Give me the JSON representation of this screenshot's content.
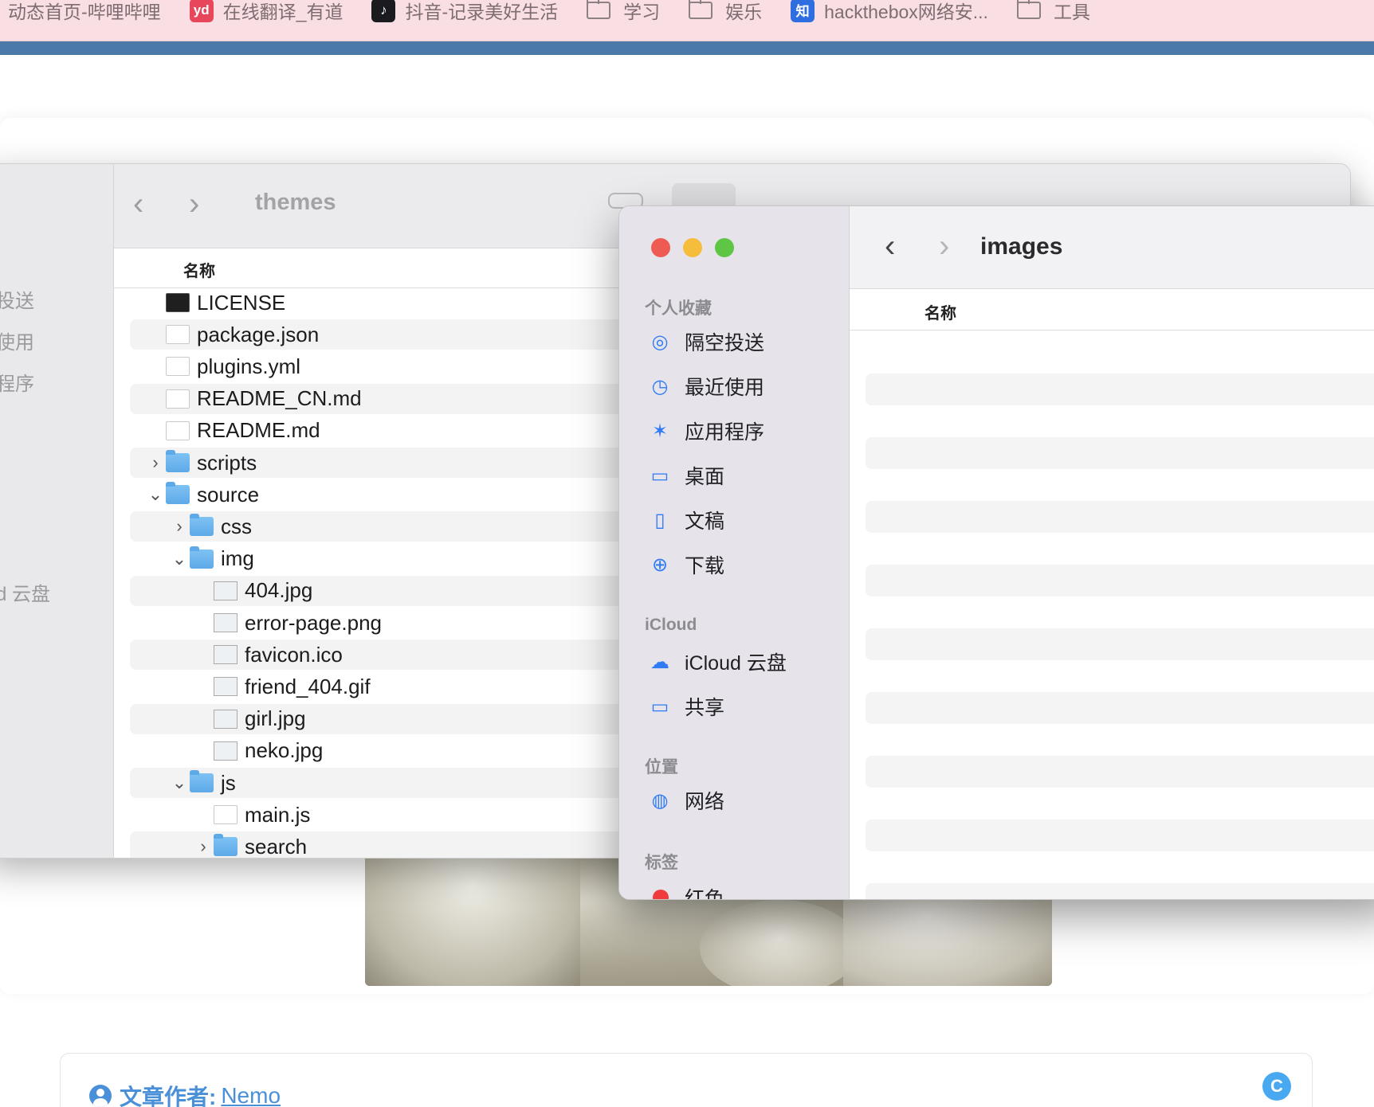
{
  "bookmarks": [
    {
      "label": "动态首页-哔哩哔哩",
      "icon": "bilibili-icon",
      "kind": "none"
    },
    {
      "label": "在线翻译_有道",
      "icon": "youdao-icon",
      "badge": "yd",
      "color": "#e8465a",
      "kind": "badge"
    },
    {
      "label": "抖音-记录美好生活",
      "icon": "douyin-icon",
      "badge": "♪",
      "color": "#1b1b1f",
      "kind": "badge"
    },
    {
      "label": "学习",
      "icon": "folder-icon",
      "kind": "folder"
    },
    {
      "label": "娱乐",
      "icon": "folder-icon",
      "kind": "folder"
    },
    {
      "label": "hackthebox网络安...",
      "icon": "zhihu-icon",
      "badge": "知",
      "color": "#2f6ee0",
      "kind": "badge"
    },
    {
      "label": "工具",
      "icon": "folder-icon",
      "kind": "folder"
    }
  ],
  "page": {
    "author_label": "文章作者:",
    "author_name": "Nemo",
    "badge": "C"
  },
  "finder_back": {
    "title": "themes",
    "column_header": "名称",
    "sidebar_partial": [
      "投送",
      "使用",
      "程序",
      "d 云盘"
    ],
    "files": [
      {
        "name": "LICENSE",
        "icon": "terminal-file-icon",
        "depth": 0,
        "expand": "",
        "alt": false
      },
      {
        "name": "package.json",
        "icon": "json-file-icon",
        "depth": 0,
        "expand": "",
        "alt": true
      },
      {
        "name": "plugins.yml",
        "icon": "yaml-file-icon",
        "depth": 0,
        "expand": "",
        "alt": false
      },
      {
        "name": "README_CN.md",
        "icon": "markdown-file-icon",
        "depth": 0,
        "expand": "",
        "alt": true
      },
      {
        "name": "README.md",
        "icon": "markdown-file-icon",
        "depth": 0,
        "expand": "",
        "alt": false
      },
      {
        "name": "scripts",
        "icon": "folder-icon",
        "depth": 0,
        "expand": "›",
        "alt": true
      },
      {
        "name": "source",
        "icon": "folder-icon",
        "depth": 0,
        "expand": "⌄",
        "alt": false
      },
      {
        "name": "css",
        "icon": "folder-icon",
        "depth": 1,
        "expand": "›",
        "alt": true
      },
      {
        "name": "img",
        "icon": "folder-icon",
        "depth": 1,
        "expand": "⌄",
        "alt": false
      },
      {
        "name": "404.jpg",
        "icon": "image-file-icon",
        "depth": 2,
        "expand": "",
        "alt": true
      },
      {
        "name": "error-page.png",
        "icon": "image-file-icon",
        "depth": 2,
        "expand": "",
        "alt": false
      },
      {
        "name": "favicon.ico",
        "icon": "image-file-icon",
        "depth": 2,
        "expand": "",
        "alt": true
      },
      {
        "name": "friend_404.gif",
        "icon": "image-file-icon",
        "depth": 2,
        "expand": "",
        "alt": false
      },
      {
        "name": "girl.jpg",
        "icon": "image-file-icon",
        "depth": 2,
        "expand": "",
        "alt": true
      },
      {
        "name": "neko.jpg",
        "icon": "image-file-icon",
        "depth": 2,
        "expand": "",
        "alt": false
      },
      {
        "name": "js",
        "icon": "folder-icon",
        "depth": 1,
        "expand": "⌄",
        "alt": true
      },
      {
        "name": "main.js",
        "icon": "js-file-icon",
        "depth": 2,
        "expand": "",
        "alt": false
      },
      {
        "name": "search",
        "icon": "folder-icon",
        "depth": 2,
        "expand": "›",
        "alt": true
      }
    ]
  },
  "finder_front": {
    "title": "images",
    "column_header": "名称",
    "sections": {
      "favorites": "个人收藏",
      "icloud": "iCloud",
      "locations": "位置",
      "tags": "标签"
    },
    "favorites": [
      {
        "label": "隔空投送",
        "icon": "airdrop-icon",
        "glyph": "◎"
      },
      {
        "label": "最近使用",
        "icon": "clock-icon",
        "glyph": "◷"
      },
      {
        "label": "应用程序",
        "icon": "apps-icon",
        "glyph": "✶"
      },
      {
        "label": "桌面",
        "icon": "desktop-icon",
        "glyph": "▭"
      },
      {
        "label": "文稿",
        "icon": "document-icon",
        "glyph": "▯"
      },
      {
        "label": "下载",
        "icon": "download-icon",
        "glyph": "⊕"
      }
    ],
    "icloud_items": [
      {
        "label": "iCloud 云盘",
        "icon": "cloud-icon",
        "glyph": "☁"
      },
      {
        "label": "共享",
        "icon": "shared-folder-icon",
        "glyph": "▭"
      }
    ],
    "location_items": [
      {
        "label": "网络",
        "icon": "network-icon",
        "glyph": "◍"
      }
    ],
    "tag_items": [
      {
        "label": "红色",
        "color": "#ef3b3b"
      }
    ]
  }
}
